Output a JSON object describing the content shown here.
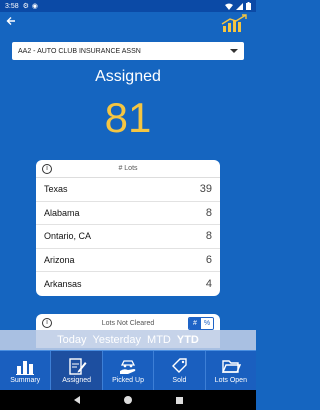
{
  "status": {
    "time": "3:58"
  },
  "header": {
    "back_icon": "arrow-left-icon",
    "logo_icon": "chart-logo-icon"
  },
  "dropdown": {
    "selected": "AA2 - AUTO CLUB INSURANCE ASSN"
  },
  "summary": {
    "heading": "Assigned",
    "count": "81"
  },
  "lots_card": {
    "title": "# Lots",
    "rows": [
      {
        "state": "Texas",
        "count": "39"
      },
      {
        "state": "Alabama",
        "count": "8"
      },
      {
        "state": "Ontario, CA",
        "count": "8"
      },
      {
        "state": "Arizona",
        "count": "6"
      },
      {
        "state": "Arkansas",
        "count": "4"
      }
    ]
  },
  "not_cleared_card": {
    "title": "Lots Not Cleared",
    "toggle_left": "#",
    "toggle_right": "%"
  },
  "periods": {
    "items": [
      "Today",
      "Yesterday",
      "MTD",
      "YTD"
    ],
    "active": "YTD"
  },
  "bottom_nav": {
    "items": [
      {
        "label": "Summary",
        "icon": "bar-chart-icon"
      },
      {
        "label": "Assigned",
        "icon": "clipboard-edit-icon"
      },
      {
        "label": "Picked Up",
        "icon": "hand-car-icon"
      },
      {
        "label": "Sold",
        "icon": "tag-icon"
      },
      {
        "label": "Lots Open",
        "icon": "folder-open-icon"
      }
    ],
    "selected": "Assigned"
  },
  "colors": {
    "primary": "#1565c0",
    "accent": "#f4c542"
  }
}
